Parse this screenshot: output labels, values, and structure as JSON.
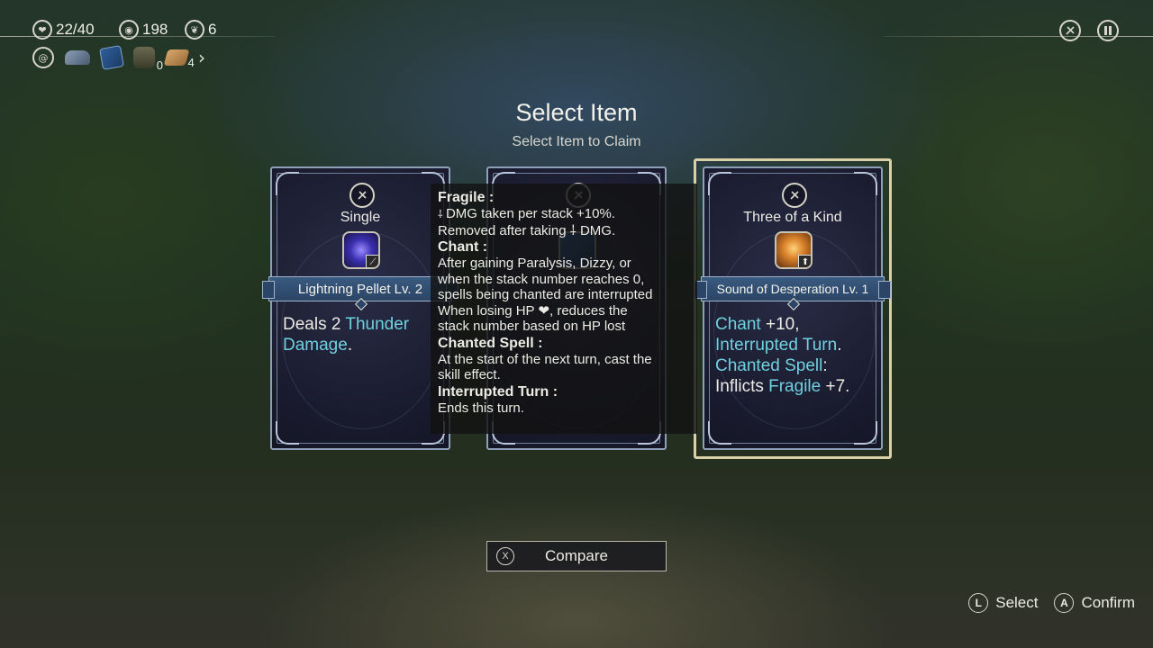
{
  "hud": {
    "hp": "22/40",
    "gold": "198",
    "leaf": "6",
    "relics": [
      {
        "icon": "spiral-icon"
      },
      {
        "icon": "ship-icon"
      },
      {
        "icon": "spellbook-icon"
      },
      {
        "icon": "potion-icon",
        "count": "0"
      },
      {
        "icon": "wood-plank-icon",
        "count": "4"
      }
    ],
    "more": "›"
  },
  "screen": {
    "title": "Select Item",
    "subtitle": "Select Item to Claim"
  },
  "cards": [
    {
      "type": "Single",
      "name": "Lightning Pellet Lv. 2",
      "desc": [
        {
          "t": "Deals 2 ",
          "kw": false
        },
        {
          "t": "Thunder Damage",
          "kw": true
        },
        {
          "t": ".",
          "kw": false
        }
      ]
    },
    {
      "type": "",
      "name": "",
      "desc": []
    },
    {
      "type": "Three of a Kind",
      "name": "Sound of Desperation Lv. 1",
      "desc": [
        {
          "t": "Chant",
          "kw": true
        },
        {
          "t": " +10,",
          "kw": false
        },
        {
          "t": "Interrupted Turn",
          "kw": true
        },
        {
          "t": ".",
          "kw": false
        },
        {
          "t": "Chanted Spell",
          "kw": true
        },
        {
          "t": ": Inflicts ",
          "kw": false
        },
        {
          "t": "Fragile",
          "kw": true
        },
        {
          "t": " +7.",
          "kw": false
        }
      ]
    }
  ],
  "tooltip": [
    {
      "term": "Fragile :",
      "lines": [
        "DMG taken per stack +10%.",
        "Removed after taking ⸸ DMG."
      ]
    },
    {
      "term": "Chant :",
      "lines": [
        "After gaining Paralysis, Dizzy, or",
        "when the stack number reaches 0,",
        "spells being chanted are interrupted",
        "When losing HP ❤, reduces the",
        "stack number based on HP lost"
      ]
    },
    {
      "term": "Chanted Spell :",
      "lines": [
        "At the start of the next turn, cast the",
        "skill effect."
      ]
    },
    {
      "term": "Interrupted Turn :",
      "lines": [
        "Ends this turn."
      ]
    }
  ],
  "compare": {
    "glyph": "X",
    "label": "Compare"
  },
  "prompts": {
    "select_glyph": "L",
    "select_label": "Select",
    "confirm_glyph": "A",
    "confirm_label": "Confirm"
  },
  "colors": {
    "keyword": "#6fd1e0",
    "selected_frame": "#d9d0a8"
  }
}
